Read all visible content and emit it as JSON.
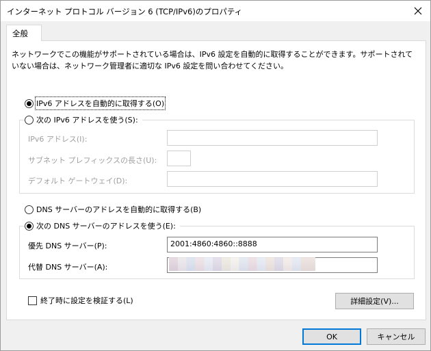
{
  "window": {
    "title": "インターネット プロトコル バージョン 6 (TCP/IPv6)のプロパティ"
  },
  "tab": {
    "label": "全般"
  },
  "description": "ネットワークでこの機能がサポートされている場合は、IPv6 設定を自動的に取得することができます。サポートされていない場合は、ネットワーク管理者に適切な IPv6 設定を問い合わせてください。",
  "ip_section": {
    "auto_label": "IPv6 アドレスを自動的に取得する(O)",
    "manual_label": "次の IPv6 アドレスを使う(S):",
    "auto_selected": true,
    "fields": {
      "address_label": "IPv6 アドレス(I):",
      "prefix_label": "サブネット プレフィックスの長さ(U):",
      "gateway_label": "デフォルト ゲートウェイ(D):",
      "address_value": "",
      "prefix_value": "",
      "gateway_value": ""
    }
  },
  "dns_section": {
    "auto_label": "DNS サーバーのアドレスを自動的に取得する(B)",
    "manual_label": "次の DNS サーバーのアドレスを使う(E):",
    "manual_selected": true,
    "preferred_label": "優先 DNS サーバー(P):",
    "preferred_value": "2001:4860:4860::8888",
    "alternate_label": "代替 DNS サーバー(A):",
    "alternate_value": ""
  },
  "validate_label": "終了時に設定を検証する(L)",
  "advanced_button": "詳細設定(V)...",
  "ok_button": "OK",
  "cancel_button": "キャンセル",
  "colors": {
    "accent": "#0078d7",
    "background": "#f0f0f0",
    "panel": "#ffffff",
    "disabled_text": "#a0a0a0"
  }
}
